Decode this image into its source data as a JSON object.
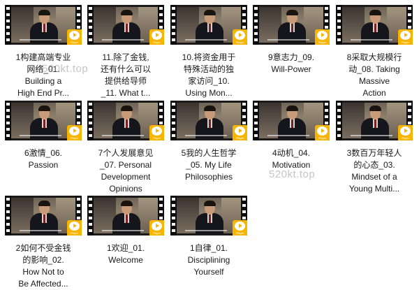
{
  "badge_text": "Player",
  "watermark": "520kt.top",
  "items": [
    {
      "label": "1构建高端专业\n网络_01.\nBuilding a\nHigh End Pr..."
    },
    {
      "label": "11.除了金钱,\n还有什么可以\n提供给导师\n_11. What t..."
    },
    {
      "label": "10.将资金用于\n特殊活动的独\n家访问_10.\nUsing Mon..."
    },
    {
      "label": "9意志力_09.\nWill-Power"
    },
    {
      "label": "8采取大规模行\n动_08. Taking\nMassive\nAction"
    },
    {
      "label": "6激情_06.\nPassion"
    },
    {
      "label": "7个人发展意见\n_07. Personal\nDevelopment\nOpinions"
    },
    {
      "label": "5我的人生哲学\n_05. My Life\nPhilosophies"
    },
    {
      "label": "4动机_04.\nMotivation"
    },
    {
      "label": "3数百万年轻人\n的心态_03.\nMindset of a\nYoung Multi..."
    },
    {
      "label": "2如何不受金钱\n的影响_02.\nHow Not to\nBe Affected..."
    },
    {
      "label": "1欢迎_01.\nWelcome"
    },
    {
      "label": "1自律_01.\nDisciplining\nYourself"
    }
  ]
}
